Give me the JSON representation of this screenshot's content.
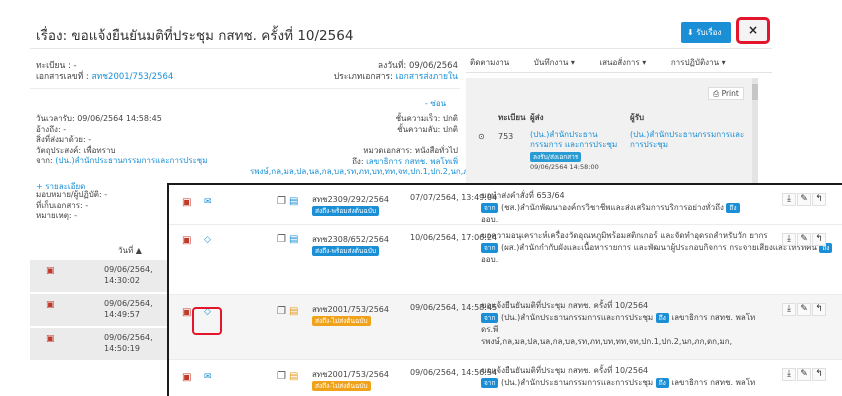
{
  "header": {
    "title": "เรื่อง: ขอแจ้งยืนยันมติที่ประชุม กสทช. ครั้งที่ 10/2564",
    "print_label": "รับเรื่อง",
    "close_label": "×"
  },
  "meta_left": {
    "reg_label": "ทะเบียน : -",
    "doc_no_label": "เอกสารเลขที่ :",
    "doc_no": "สทช2001/753/2564",
    "received": "วันเวลารับ: 09/06/2564 14:58:45",
    "ref": "อ้างถึง: -",
    "attach": "สิ่งที่ส่งมาด้วย: -",
    "purpose": "วัตถุประสงค์: เพื่อทราบ",
    "from_label": "จาก:",
    "from": "(ปน.)สำนักประธานกรรมการและการประชุม",
    "more": "+ รายละเอียด",
    "assign": "มอบหมาย/ผู้ปฏิบัติ: -",
    "store": "ที่เก็บเอกสาร: -",
    "note": "หมายเหตุ: -"
  },
  "meta_right": {
    "date": "ลงวันที่: 09/06/2564",
    "type_label": "ประเภทเอกสาร:",
    "type": "เอกสารส่งภายใน",
    "hide": "- ซ่อน",
    "speed": "ชั้นความเร็ว: ปกติ",
    "secret": "ชั้นความลับ: ปกติ",
    "category": "หมวดเอกสาร: หนังสือทั่วไป",
    "to_label": "ถึง:",
    "to": "เลขาธิการ กสทช. พลโทเพิ่",
    "cc": "รพงษ์,กล,มล,ปล,นล,กล,บล,รท,ภท,บท,ทท,จท,ปก.1,ปก.2,นก,ภก,ดก,"
  },
  "tabs": [
    "ติดตามงาน",
    "บันทึกงาน ▾",
    "เสนอสั่งการ ▾",
    "การปฏิบัติงาน ▾"
  ],
  "right_panel": {
    "print": "Print",
    "col_reg": "ทะเบียน",
    "col_sender": "ผู้ส่ง",
    "col_recv": "ผู้รับ",
    "reg": "753",
    "sender": "(ปน.)สำนักประธานกรรมการ และการประชุม",
    "badge": "ลงรับ/ส่งเอกสาร",
    "time": "09/06/2564 14:58:00",
    "recv": "(ปน.)สำนักประธานกรรมการและ การประชุม"
  },
  "left_list": {
    "col": "วันที่ ▲",
    "items": [
      {
        "date": "09/06/2564,",
        "time": "14:30:02"
      },
      {
        "date": "09/06/2564,",
        "time": "14:49:57"
      },
      {
        "date": "09/06/2564,",
        "time": "14:50:19"
      }
    ]
  },
  "rows": [
    {
      "code": "สทช2309/292/2564",
      "badge": "ส่งถึง-พร้อมส่งต้นฉบับ",
      "badge_color": "blue",
      "date": "07/07/2564, 13:49:04",
      "subject": "ขอนำส่งคำสั่งที่ 653/64",
      "line2_from_badge": "จาก",
      "line2": "(ชส.)สำนักพัฒนาองค์กรวิชาชีพและส่งเสริมการบริการอย่างทั่วถึง",
      "line2_to_badge": "ถึง",
      "line3": "ออบ."
    },
    {
      "code": "สทช2308/652/2564",
      "badge": "ส่งถึง-พร้อมส่งต้นฉบับ",
      "badge_color": "blue",
      "date": "10/06/2564, 17:06:24",
      "subject": "ขอความอนุเคราะห์เครื่องวัดอุณหภูมิพร้อมสติกเกอร์ และจัดทำอุดรถสำหรับวัก ยากร",
      "line2_from_badge": "จาก",
      "line2": "(ผส.)สำนักกำกับผังและเนื้อหารายการ และพัฒนาผู้ประกอบกิจการ กระจายเสียงและโทรทัศน์",
      "line2_to_badge": "ถึง",
      "line3": "ออบ."
    },
    {
      "code": "สทช2001/753/2564",
      "badge": "ส่งถึง-ไม่ส่งต้นฉบับ",
      "badge_color": "orange",
      "date": "09/06/2564, 14:58:45",
      "subject": "ขอแจ้งยืนยันมติที่ประชุม กสทช. ครั้งที่ 10/2564",
      "line2_from_badge": "จาก",
      "line2": "(ปน.)สำนักประธานกรรมการและการประชุม",
      "line2_to_badge": "ถึง",
      "line3": "เลขาธิการ กสทช. พลโท",
      "line4": "ดร.พี",
      "line5": "รพงษ์,กล,มล,ปล,นล,กล,บล,รท,ภท,บท,ทท,จท,ปก.1,ปก.2,นก,ภก,ดก,มก,"
    },
    {
      "code": "สทช2001/753/2564",
      "badge": "ส่งถึง-ไม่ส่งต้นฉบับ",
      "badge_color": "orange",
      "date": "09/06/2564, 14:56:54",
      "subject": "ขอแจ้งยืนยันมติที่ประชุม กสทช. ครั้งที่ 10/2564",
      "line2_from_badge": "จาก",
      "line2": "(ปน.)สำนักประธานกรรมการและการประชุม",
      "line2_to_badge": "ถึง",
      "line3": "เลขาธิการ กสทช. พลโท"
    }
  ],
  "colors": {
    "accent": "#1a8fd6",
    "highlight": "#e3162b",
    "orange": "#f0a21a"
  }
}
